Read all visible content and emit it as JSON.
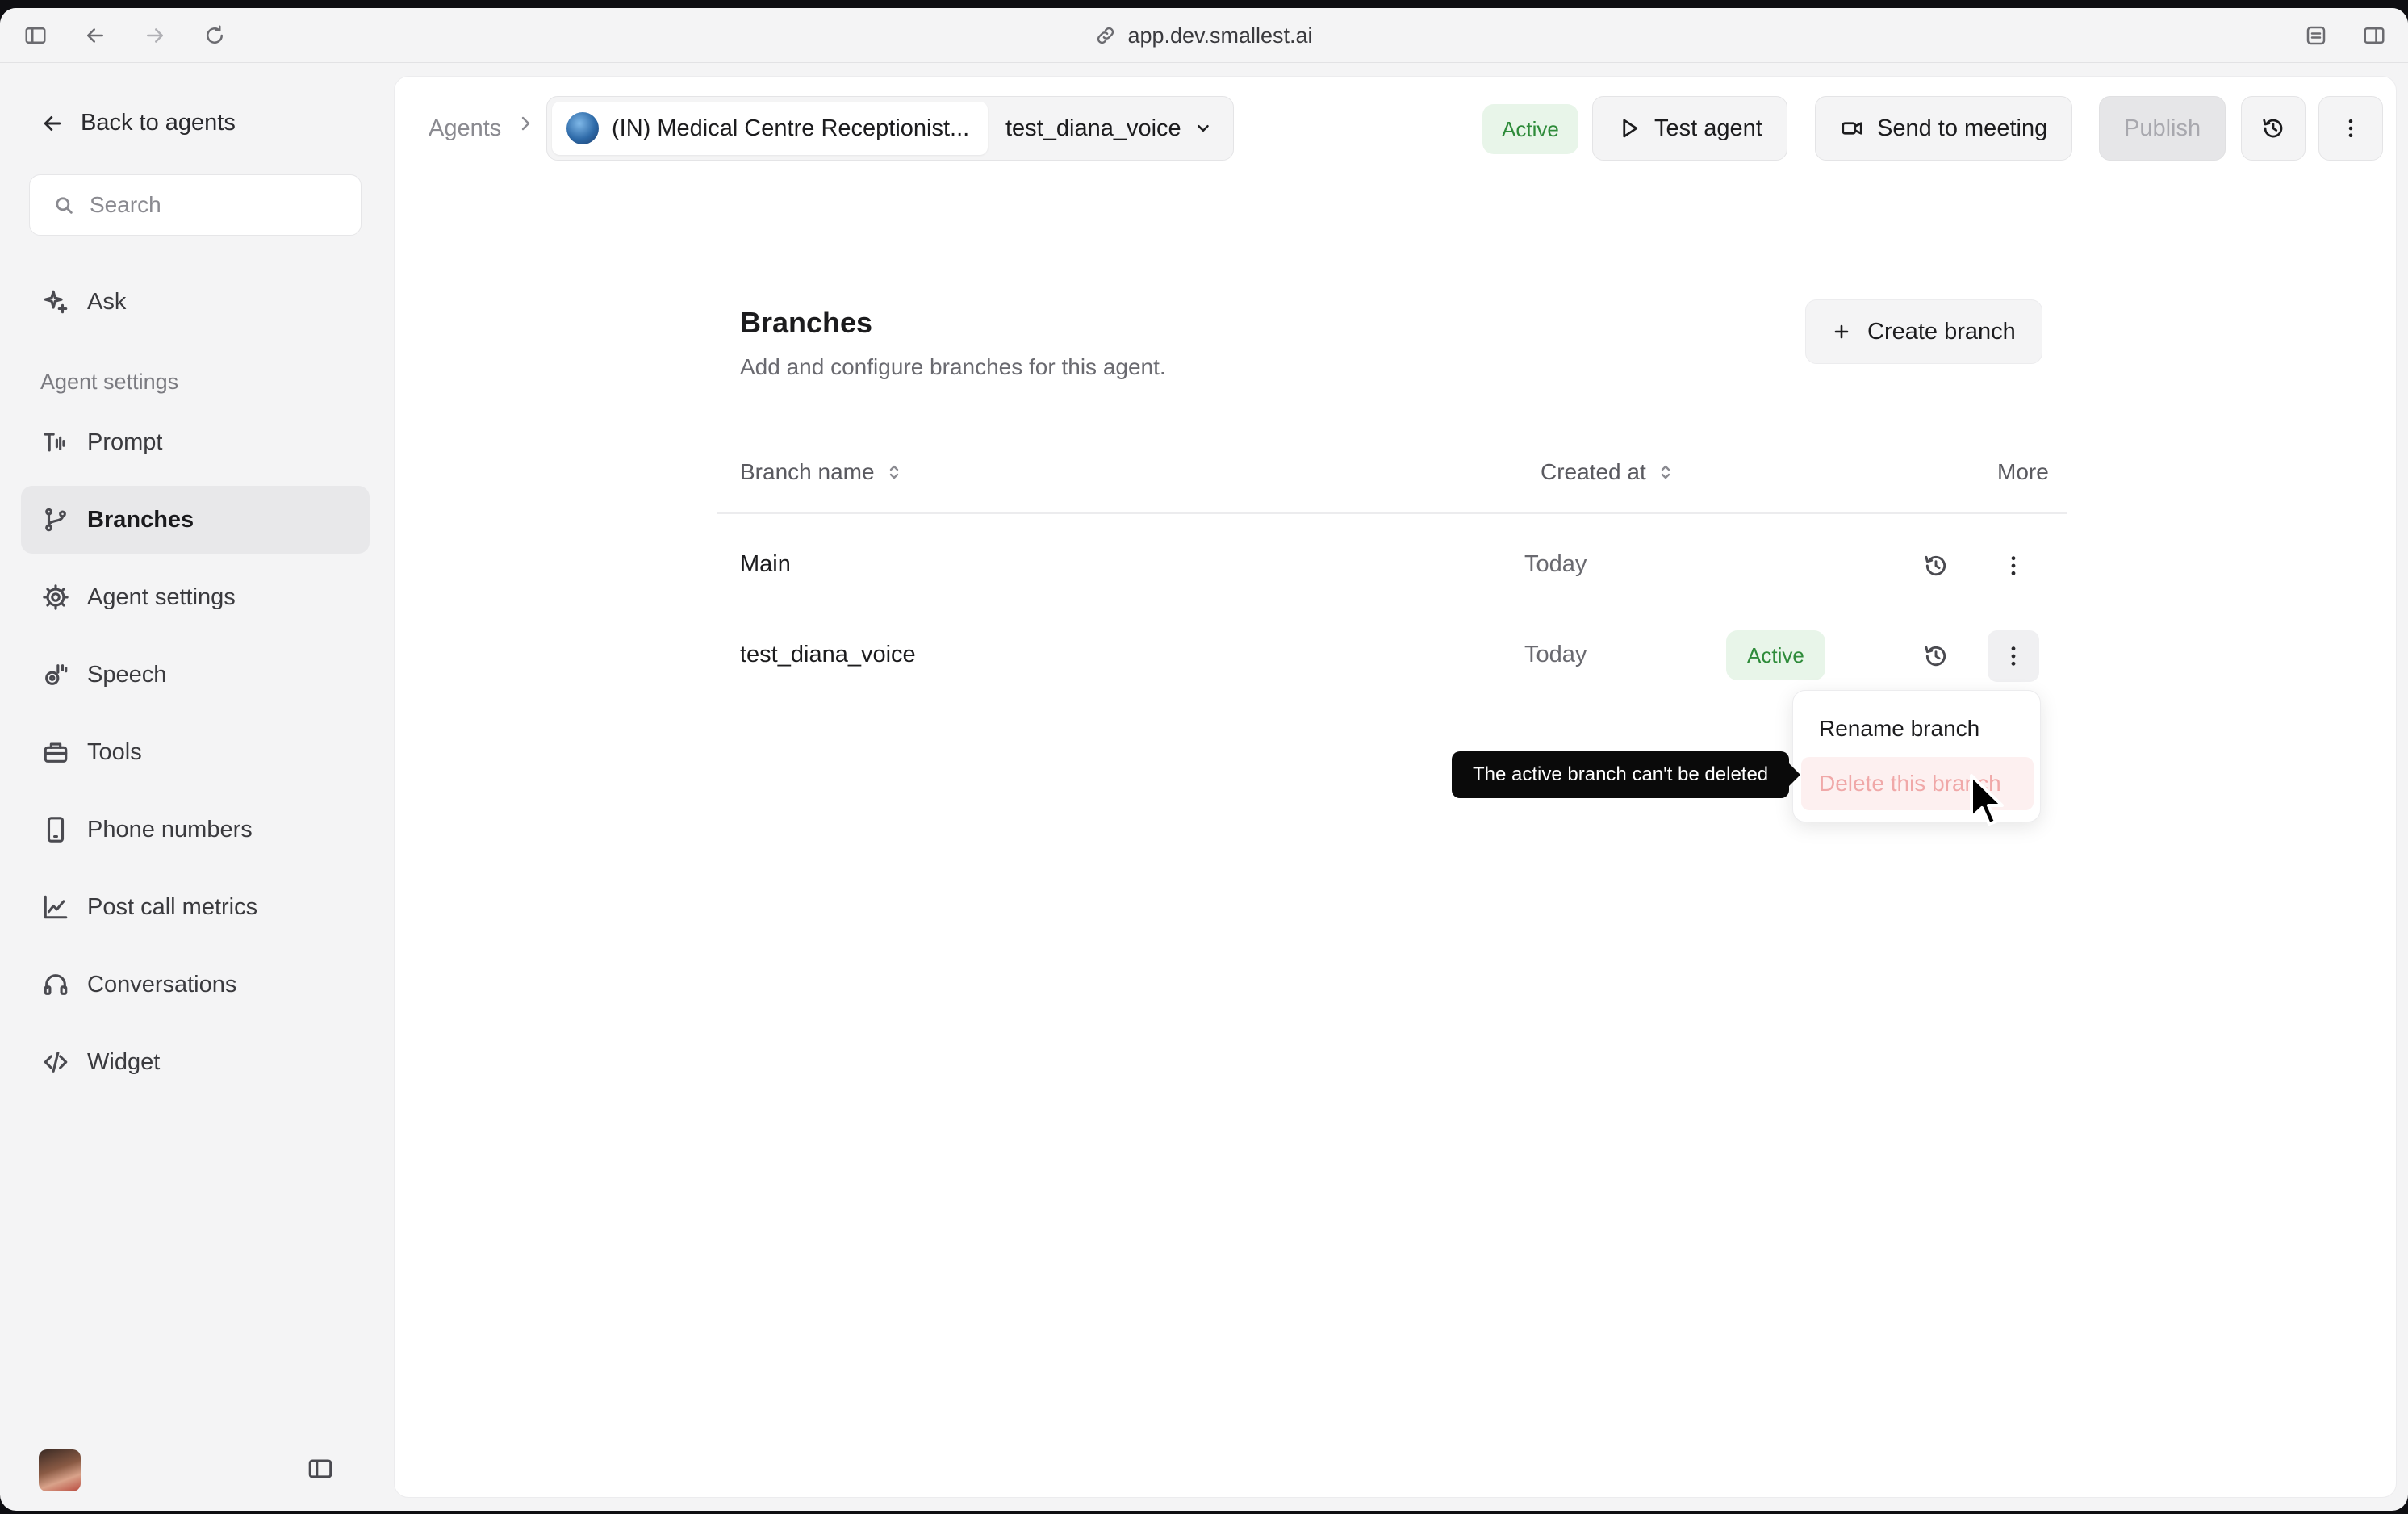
{
  "browser": {
    "url": "app.dev.smallest.ai",
    "icons": [
      "sidebar-toggle-icon",
      "back-arrow-icon",
      "forward-arrow-icon",
      "reload-icon",
      "link-icon",
      "extension-icon",
      "split-view-icon"
    ]
  },
  "sidebar": {
    "back_label": "Back to agents",
    "search_placeholder": "Search",
    "ask_label": "Ask",
    "section_label": "Agent settings",
    "items": [
      {
        "label": "Prompt",
        "icon": "prompt-icon"
      },
      {
        "label": "Branches",
        "icon": "branch-icon",
        "selected": true
      },
      {
        "label": "Agent settings",
        "icon": "gear-icon"
      },
      {
        "label": "Speech",
        "icon": "speech-icon"
      },
      {
        "label": "Tools",
        "icon": "toolbox-icon"
      },
      {
        "label": "Phone numbers",
        "icon": "phone-icon"
      },
      {
        "label": "Post call metrics",
        "icon": "chart-line-icon"
      },
      {
        "label": "Conversations",
        "icon": "headset-icon"
      },
      {
        "label": "Widget",
        "icon": "code-icon"
      }
    ]
  },
  "header": {
    "breadcrumb_root": "Agents",
    "agent_name": "(IN) Medical Centre Receptionist...",
    "branch_name": "test_diana_voice",
    "status": "Active",
    "test_agent_label": "Test agent",
    "send_to_meeting_label": "Send to meeting",
    "publish_label": "Publish"
  },
  "page": {
    "title": "Branches",
    "subtitle": "Add and configure branches for this agent.",
    "create_label": "Create branch"
  },
  "table": {
    "columns": [
      "Branch name",
      "Created at",
      "More"
    ],
    "rows": [
      {
        "name": "Main",
        "badge": "",
        "created_at": "Today"
      },
      {
        "name": "test_diana_voice",
        "badge": "Active",
        "created_at": "Today"
      }
    ]
  },
  "menu": {
    "rename_label": "Rename branch",
    "delete_label": "Delete this branch"
  },
  "tooltip": {
    "text": "The active branch can't be deleted"
  },
  "colors": {
    "active_green": "#2e8b3a",
    "active_bg": "#e8f5e9",
    "danger_text": "#f0a8a8"
  }
}
